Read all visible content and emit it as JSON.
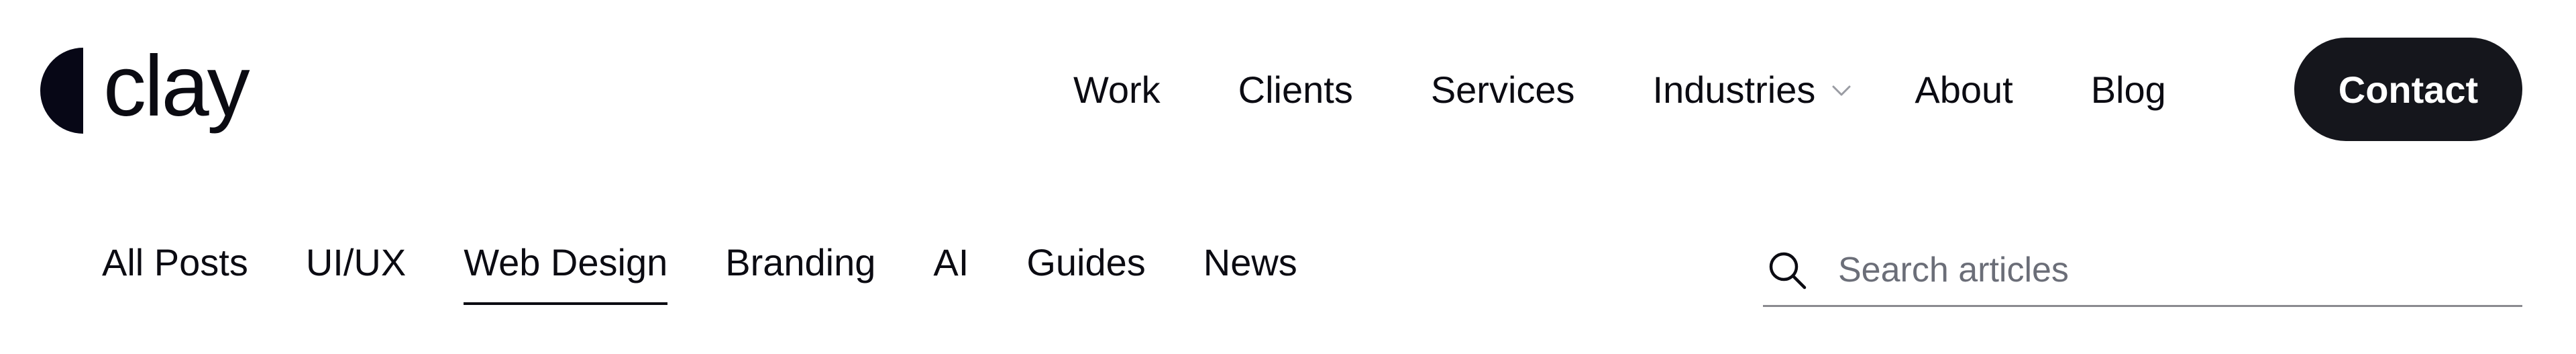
{
  "brand": {
    "name": "clay"
  },
  "nav": {
    "items": [
      {
        "label": "Work"
      },
      {
        "label": "Clients"
      },
      {
        "label": "Services"
      },
      {
        "label": "Industries",
        "has_dropdown": true
      },
      {
        "label": "About"
      },
      {
        "label": "Blog"
      }
    ],
    "contact_label": "Contact"
  },
  "categories": {
    "items": [
      {
        "label": "All Posts"
      },
      {
        "label": "UI/UX"
      },
      {
        "label": "Web Design",
        "active": true
      },
      {
        "label": "Branding"
      },
      {
        "label": "AI"
      },
      {
        "label": "Guides"
      },
      {
        "label": "News"
      }
    ],
    "active_index": 2
  },
  "search": {
    "placeholder": "Search articles",
    "value": "",
    "icon": "search-icon"
  },
  "colors": {
    "text": "#0b0b12",
    "button_bg": "#15161c",
    "button_text": "#ffffff",
    "placeholder": "#6b6e78",
    "underline": "#8a8a8f"
  }
}
